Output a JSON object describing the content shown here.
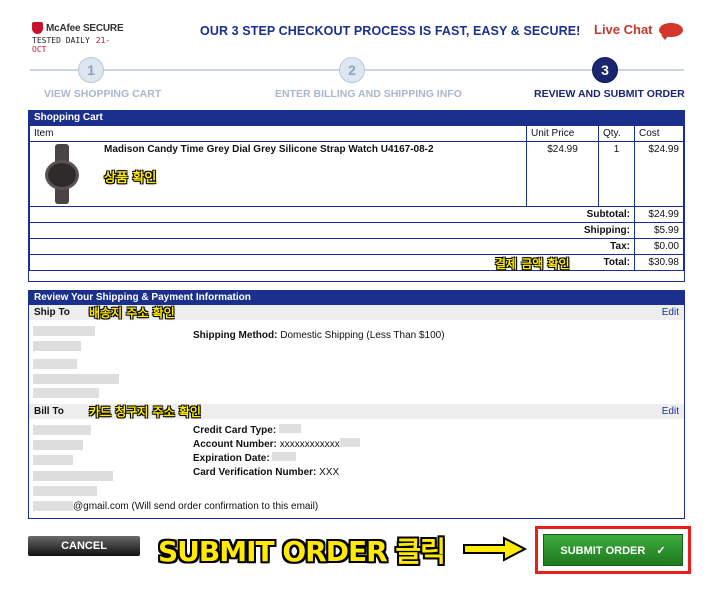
{
  "mcafee": {
    "brand": "McAfee SECURE",
    "tested": "TESTED DAILY",
    "date": "21-OCT"
  },
  "headline": "OUR 3 STEP CHECKOUT PROCESS IS FAST, EASY & SECURE!",
  "live_chat": "Live Chat",
  "steps": [
    {
      "num": "1",
      "label": "VIEW SHOPPING CART",
      "state": "inactive"
    },
    {
      "num": "2",
      "label": "ENTER BILLING AND SHIPPING INFO",
      "state": "inactive"
    },
    {
      "num": "3",
      "label": "REVIEW AND SUBMIT ORDER",
      "state": "active"
    }
  ],
  "cart": {
    "title": "Shopping Cart",
    "headers": {
      "item": "Item",
      "unit_price": "Unit Price",
      "qty": "Qty.",
      "cost": "Cost"
    },
    "item": {
      "name": "Madison Candy Time Grey Dial Grey Silicone Strap Watch U4167-08-2",
      "unit_price": "$24.99",
      "qty": "1",
      "cost": "$24.99"
    },
    "totals": {
      "subtotal_label": "Subtotal:",
      "subtotal": "$24.99",
      "shipping_label": "Shipping:",
      "shipping": "$5.99",
      "tax_label": "Tax:",
      "tax": "$0.00",
      "total_label": "Total:",
      "total": "$30.98"
    }
  },
  "review": {
    "title": "Review Your Shipping & Payment Information",
    "ship_to": "Ship To",
    "bill_to": "Bill To",
    "edit": "Edit",
    "shipping_method_label": "Shipping Method:",
    "shipping_method_value": "Domestic Shipping (Less Than $100)",
    "card_type_label": "Credit Card Type:",
    "account_label": "Account Number:",
    "account_value": "xxxxxxxxxxxx",
    "expiration_label": "Expiration Date:",
    "cvn_label": "Card Verification Number:",
    "cvn_value": "XXX",
    "email_suffix": "@gmail.com",
    "email_note": "(Will send order confirmation to this email)"
  },
  "annotations": {
    "product": "상품 확인",
    "payment": "결제 금액 확인",
    "ship": "배송지 주소 확인",
    "bill": "카드 청구지 주소 확인",
    "submit": "SUBMIT ORDER 클릭"
  },
  "buttons": {
    "cancel": "CANCEL",
    "submit": "SUBMIT ORDER"
  }
}
